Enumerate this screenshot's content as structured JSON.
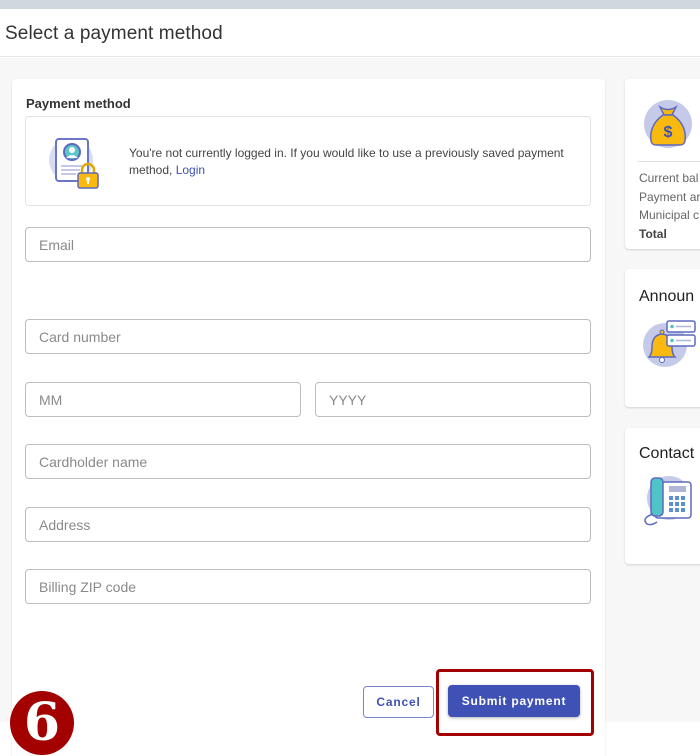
{
  "header": {
    "title": "Select a payment method"
  },
  "payment_form": {
    "section_title": "Payment method",
    "login_notice": {
      "text": "You're not currently logged in. If you would like to use a previously saved payment method, ",
      "link_label": "Login"
    },
    "fields": {
      "email": {
        "placeholder": "Email",
        "value": ""
      },
      "card_number": {
        "placeholder": "Card number",
        "value": ""
      },
      "exp_month": {
        "placeholder": "MM",
        "value": ""
      },
      "exp_year": {
        "placeholder": "YYYY",
        "value": ""
      },
      "cardholder_name": {
        "placeholder": "Cardholder name",
        "value": ""
      },
      "address": {
        "placeholder": "Address",
        "value": ""
      },
      "billing_zip": {
        "placeholder": "Billing ZIP code",
        "value": ""
      }
    },
    "buttons": {
      "cancel_label": "Cancel",
      "submit_label": "Submit payment"
    }
  },
  "sidebar": {
    "balance_card": {
      "icon": "money-bag-icon",
      "items": [
        "Current bal",
        "Payment ar",
        "Municipal c"
      ],
      "total_label": "Total"
    },
    "announcements_card": {
      "title": "Announ",
      "icon": "bell-announcement-icon"
    },
    "contact_card": {
      "title": "Contact",
      "icon": "desk-phone-icon"
    }
  },
  "annotation": {
    "step_number": "6",
    "highlight_color": "#a30000"
  },
  "colors": {
    "accent": "#3f51b5",
    "icon_yellow": "#f9b90f",
    "icon_bg": "#c5cae9",
    "icon_teal": "#4fc3c7"
  }
}
